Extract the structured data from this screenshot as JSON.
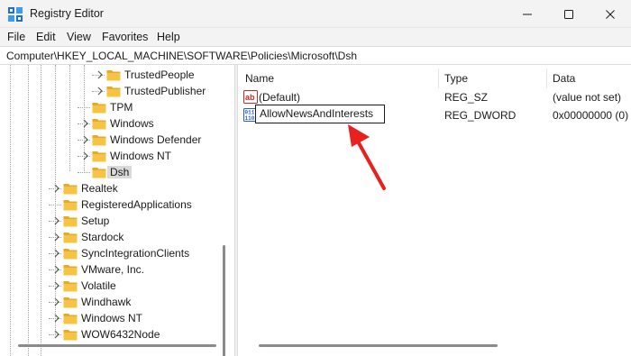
{
  "window": {
    "title": "Registry Editor"
  },
  "menu": [
    "File",
    "Edit",
    "View",
    "Favorites",
    "Help"
  ],
  "address": "Computer\\HKEY_LOCAL_MACHINE\\SOFTWARE\\Policies\\Microsoft\\Dsh",
  "tree": {
    "items": [
      {
        "label": "TrustedPeople",
        "expandable": true
      },
      {
        "label": "TrustedPublisher",
        "expandable": true
      },
      {
        "label": "TPM",
        "expandable": false
      },
      {
        "label": "Windows",
        "expandable": true
      },
      {
        "label": "Windows Defender",
        "expandable": true
      },
      {
        "label": "Windows NT",
        "expandable": true
      },
      {
        "label": "Dsh",
        "expandable": false,
        "selected": true
      },
      {
        "label": "Realtek",
        "expandable": true
      },
      {
        "label": "RegisteredApplications",
        "expandable": false
      },
      {
        "label": "Setup",
        "expandable": true
      },
      {
        "label": "Stardock",
        "expandable": true
      },
      {
        "label": "SyncIntegrationClients",
        "expandable": true
      },
      {
        "label": "VMware, Inc.",
        "expandable": true
      },
      {
        "label": "Volatile",
        "expandable": true
      },
      {
        "label": "Windhawk",
        "expandable": true
      },
      {
        "label": "Windows NT",
        "expandable": true
      },
      {
        "label": "WOW6432Node",
        "expandable": true
      }
    ]
  },
  "list": {
    "columns": [
      "Name",
      "Type",
      "Data"
    ],
    "rows": [
      {
        "name": "(Default)",
        "type": "REG_SZ",
        "data": "(value not set)",
        "icon": "string-value-icon"
      },
      {
        "name": "AllowNewsAndInterests",
        "type": "REG_DWORD",
        "data": "0x00000000 (0)",
        "icon": "binary-value-icon",
        "editing": true
      }
    ]
  },
  "colors": {
    "folder": "#f6c343",
    "arrow": "#e8201e",
    "chrome": "#f3f3f3"
  }
}
